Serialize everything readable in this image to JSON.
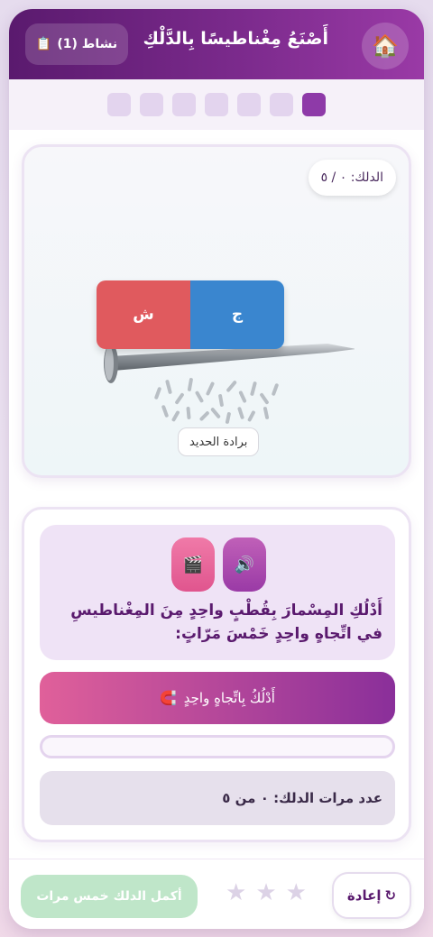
{
  "header": {
    "home_icon": "home-icon",
    "title": "أَصْنَعُ مِغْناطيسًا بِالدَّلْكِ",
    "activity_label": "نشاط (1)",
    "activity_icon": "clipboard-icon"
  },
  "steps": {
    "total": 7,
    "current": 1
  },
  "stage": {
    "rub_counter": "الدلك: ٠ / ٥",
    "pole_south": "ش",
    "pole_north": "ج",
    "filings_label": "برادة الحديد"
  },
  "instruction": {
    "speaker_icon": "speaker-icon",
    "video_icon": "clapper-icon",
    "text": "أَدْلُكِ المِسْمارَ بِقُطْبٍ واحِدٍ مِنَ المِغْناطيسِ في اتِّجاهٍ واحِدٍ خَمْسَ مَرّاتٍ:",
    "rub_button_label": "أَدْلُكُ بِاتِّجاهٍ واحِدٍ",
    "rub_button_icon": "magnet-icon",
    "progress": 0,
    "count_text": "عدد مرات الدلك: ٠ من ٥"
  },
  "footer": {
    "reset_label": "إعادة",
    "reset_icon": "refresh-icon",
    "stars_total": 3,
    "stars_earned": 0,
    "complete_label": "أكمل الدلك خمس مرات"
  },
  "colors": {
    "header_start": "#5a1a6e",
    "header_end": "#9a3aa6",
    "pole_south": "#e05a5e",
    "pole_north": "#3a86cf",
    "complete_disabled": "#bfe6c9"
  }
}
